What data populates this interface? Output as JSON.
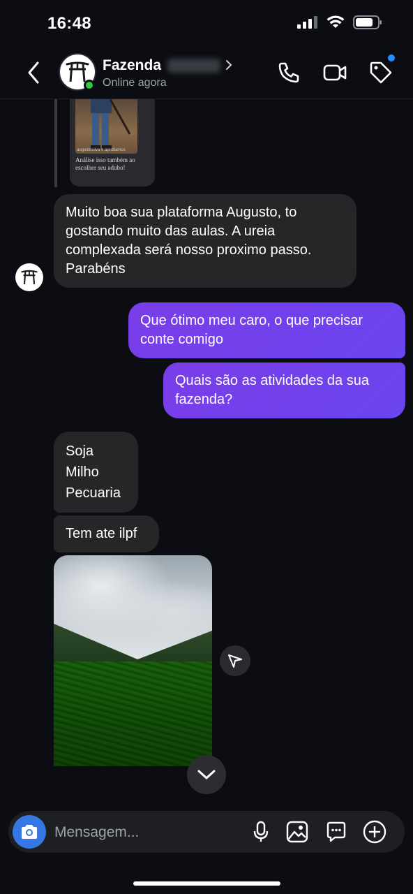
{
  "status_bar": {
    "time": "16:48"
  },
  "header": {
    "name": "Fazenda",
    "status": "Online agora",
    "icons": [
      "back-chevron-icon",
      "phone-icon",
      "video-icon",
      "tag-icon"
    ]
  },
  "story": {
    "small_caption": "augustosilva e aprotiamos",
    "caption": "Análise isso também ao escolher seu adubo!"
  },
  "messages": [
    {
      "direction": "incoming",
      "text": "Muito boa sua plataforma Augusto, to gostando muito das aulas. A ureia complexada será nosso proximo passo. Parabéns"
    },
    {
      "direction": "outgoing",
      "text": "Que ótimo meu caro, o que precisar conte comigo"
    },
    {
      "direction": "outgoing",
      "text": "Quais são as atividades da sua fazenda?"
    },
    {
      "direction": "incoming",
      "lines": [
        "Soja",
        "Milho",
        "Pecuaria"
      ]
    },
    {
      "direction": "incoming",
      "text": "Tem ate ilpf"
    }
  ],
  "composer": {
    "placeholder": "Mensagem...",
    "icons": [
      "camera-icon",
      "microphone-icon",
      "gallery-icon",
      "sticker-icon",
      "plus-icon"
    ]
  },
  "colors": {
    "background": "#0b0d12",
    "incoming_bubble": "#262629",
    "outgoing_bubble": "#7a3de8",
    "camera_button": "#3578e5",
    "online": "#2ecc40"
  }
}
